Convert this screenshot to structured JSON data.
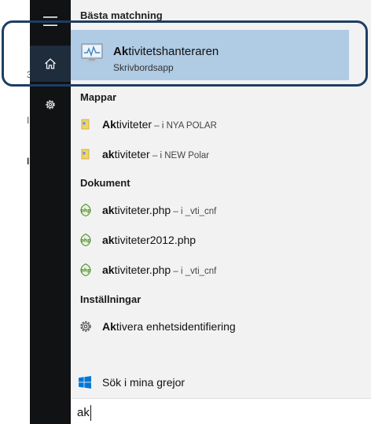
{
  "page_fragments": [
    "3",
    "I",
    "I"
  ],
  "groups": {
    "best": "Bästa matchning",
    "folders": "Mappar",
    "documents": "Dokument",
    "settings": "Inställningar"
  },
  "best_match": {
    "title_bold": "Ak",
    "title_rest": "tivitetshanteraren",
    "subtitle": "Skrivbordsapp",
    "icon": "task-manager-icon"
  },
  "folders": [
    {
      "bold": "Ak",
      "rest": "tiviteter",
      "location": " – i NYA POLAR",
      "icon": "folder-icon"
    },
    {
      "bold": "ak",
      "rest": "tiviteter",
      "location": " – i NEW Polar",
      "icon": "folder-icon"
    }
  ],
  "documents": [
    {
      "bold": "ak",
      "rest": "tiviteter.php",
      "location": " – i _vti_cnf",
      "icon": "php-file-icon"
    },
    {
      "bold": "ak",
      "rest": "tiviteter2012.php",
      "location": "",
      "icon": "php-file-icon"
    },
    {
      "bold": "ak",
      "rest": "tiviteter.php",
      "location": " – i _vti_cnf",
      "icon": "php-file-icon"
    }
  ],
  "settings_items": [
    {
      "bold": "Ak",
      "rest": "tivera enhetsidentifiering",
      "icon": "gear-icon"
    }
  ],
  "search_mine": {
    "label": "Sök i mina grejor",
    "icon": "windows-logo-icon"
  },
  "search": {
    "value": "ak"
  },
  "colors": {
    "rail": "#111214",
    "panel": "#f2f2f2",
    "selected": "#b0cbe4",
    "highlight_frame": "#1d3e63",
    "windows_blue": "#0078d7",
    "php_green": "#4a8a2a"
  }
}
